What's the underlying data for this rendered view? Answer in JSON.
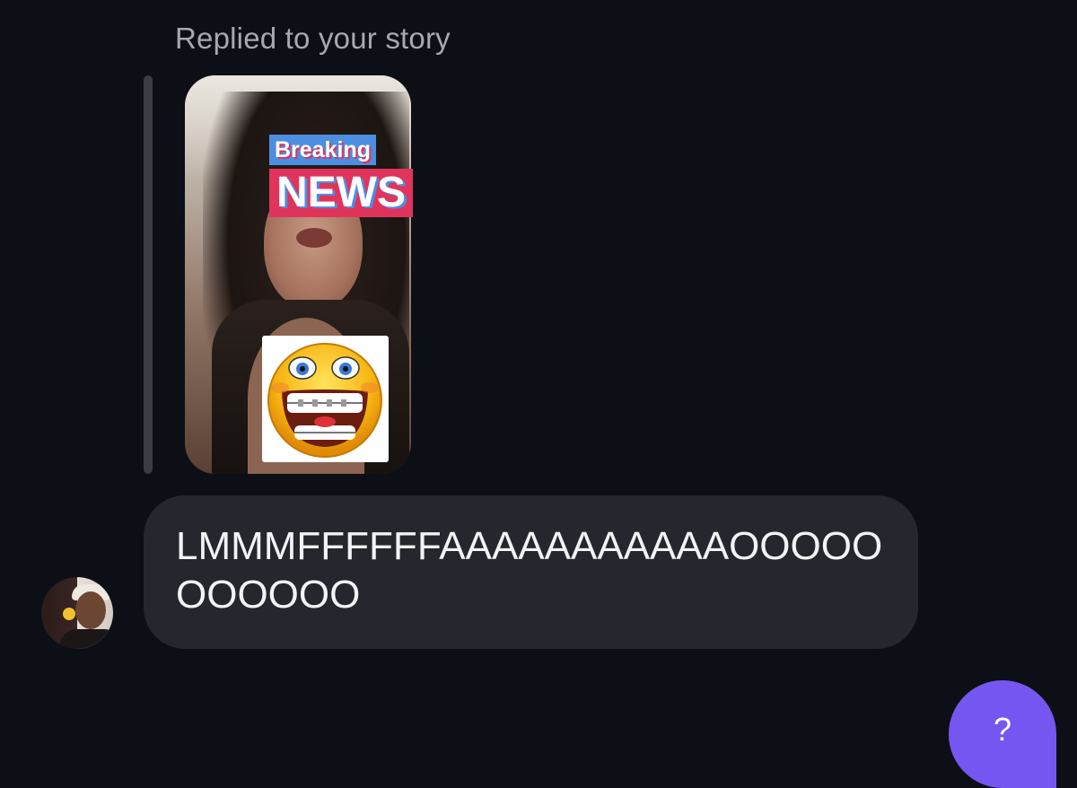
{
  "reply_header": {
    "label": "Replied to your story"
  },
  "story": {
    "sticker_breaking": "Breaking",
    "sticker_news": "NEWS",
    "emoji_sticker": "grinning-face-braces-icon"
  },
  "message": {
    "text": "LMMMFFFFFFAAAAAAAAAAAOOOOOOOOOOO"
  },
  "help": {
    "label": "?"
  },
  "colors": {
    "background": "#0c0f16",
    "bubble": "#24272d",
    "help_button": "#7556f0",
    "news_red": "#e0345d",
    "breaking_blue": "#4c8ee0"
  }
}
